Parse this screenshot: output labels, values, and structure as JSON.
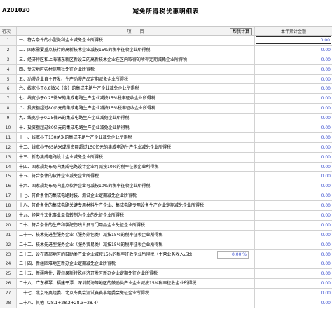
{
  "header": {
    "form_code": "A201030",
    "title": "减免所得税优惠明细表"
  },
  "table": {
    "col_no": "行次",
    "col_item": "项　　目",
    "col_amount": "本年累计金额",
    "calc_button": "帮我计算",
    "rows": [
      {
        "no": "1",
        "item": "一、符合条件的小型微利企业减免企业所得税",
        "amount": "0.00"
      },
      {
        "no": "2",
        "item": "二、国家需要重点扶持的高新技术企业减按15%的税率征收企业所得税",
        "amount": "0.00"
      },
      {
        "no": "3",
        "item": "三、经济特区和上海浦东新区新设立的高新技术企业在区内取得的所得定期减免企业所得税",
        "amount": "0.00"
      },
      {
        "no": "4",
        "item": "四、受灾地区农村信用社免征企业所得税",
        "amount": "0.00"
      },
      {
        "no": "5",
        "item": "五、动漫企业自主开发、生产动漫产品定期减免企业所得税",
        "amount": "0.00"
      },
      {
        "no": "6",
        "item": "六、线宽小于0.8微米（含）的集成电路生产企业减免企业所得税",
        "amount": "0.00"
      },
      {
        "no": "7",
        "item": "七、线宽小于0.25微米的集成电路生产企业减按15%税率征收企业所得税",
        "amount": "0.00"
      },
      {
        "no": "8",
        "item": "八、投资额超过80亿元的集成电路生产企业减按15%税率征收企业所得税",
        "amount": "0.00"
      },
      {
        "no": "9",
        "item": "九、线宽小于0.25微米的集成电路生产企业减免企业所得税",
        "amount": "0.00"
      },
      {
        "no": "10",
        "item": "十、投资额超过80亿元的集成电路生产企业减免企业所得税",
        "amount": "0.00"
      },
      {
        "no": "11",
        "item": "十一、线宽小于130纳米的集成电路生产企业减免企业所得税",
        "amount": "0.00"
      },
      {
        "no": "12",
        "item": "十二、线宽小于65纳米或投资额超过150亿元的集成电路生产企业减免企业所得税",
        "amount": "0.00"
      },
      {
        "no": "13",
        "item": "十三、新办集成电路设计企业减免企业所得税",
        "amount": "0.00"
      },
      {
        "no": "14",
        "item": "十四、国家规划布局内集成电路设计企业可减按10%的税率征收企业所得税",
        "amount": "0.00"
      },
      {
        "no": "15",
        "item": "十五、符合条件的软件企业减免企业所得税",
        "amount": "0.00"
      },
      {
        "no": "16",
        "item": "十六、国家规划布局内重点软件企业可减按10%的税率征收企业所得税",
        "amount": "0.00"
      },
      {
        "no": "17",
        "item": "十七、符合条件的集成电路封装、测试企业定期减免企业所得税",
        "amount": "0.00"
      },
      {
        "no": "18",
        "item": "十八、符合条件的集成电路关键专用材料生产企业、集成电路专用设备生产企业定期减免企业所得税",
        "amount": "0.00"
      },
      {
        "no": "19",
        "item": "十九、经营性文化事业单位转制为企业的免征企业所得税",
        "amount": "0.00"
      },
      {
        "no": "20",
        "item": "二十、符合条件的生产和装配伤残人员专门用品企业免征企业所得税",
        "amount": "0.00"
      },
      {
        "no": "21",
        "item": "二十一、技术先进型服务企业（服务外包类）减按15%的税率征收企业所得税",
        "amount": "0.00"
      },
      {
        "no": "22",
        "item": "二十二、技术先进型服务企业（服务贸易类）减按15%的税率征收企业所得税",
        "amount": "0.00"
      },
      {
        "no": "23",
        "item": "二十三、设在西部地区的鼓励类产业企业减按15%的税率征收企业所得税（主营业务收入占比",
        "amount": "0.00",
        "rate": "0.00 %"
      },
      {
        "no": "24",
        "item": "二十四、新疆困难地区新办企业定期减免企业所得税",
        "amount": "0.00"
      },
      {
        "no": "25",
        "item": "二十五、新疆喀什、霍尔果斯特殊经济开发区新办企业定期免征企业所得税",
        "amount": "0.00"
      },
      {
        "no": "26",
        "item": "二十六、广东横琴、福建平潭、深圳前海等地区的鼓励类产业企业减按15%税率征收企业所得税",
        "amount": "0.00"
      },
      {
        "no": "27",
        "item": "二十七、北京冬奥组委、北京冬奥会测试赛赛事组委会免征企业所得税",
        "amount": "0.00"
      },
      {
        "no": "28",
        "item": "二十八、其他（28.1+28.2+28.3+28.4）",
        "amount": "0.00"
      }
    ]
  }
}
